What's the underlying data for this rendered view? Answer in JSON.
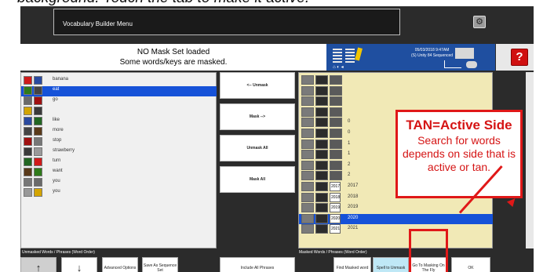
{
  "caption": "background. Touch the tab to make it active.",
  "window": {
    "title": "Vocabulary Builder Menu"
  },
  "status": {
    "line1": "NO Mask Set loaded",
    "line2": "Some words/keys are masked.",
    "datetime_line1": "05/03/2018 9:47AM",
    "datetime_line2": "(S) Unity 84 Sequenced"
  },
  "left_list": {
    "items": [
      {
        "label": "banana"
      },
      {
        "label": "eat",
        "selected": true
      },
      {
        "label": "go"
      },
      {
        "label": ""
      },
      {
        "label": "like"
      },
      {
        "label": "more"
      },
      {
        "label": "stop"
      },
      {
        "label": "strawberry"
      },
      {
        "label": "turn"
      },
      {
        "label": "want"
      },
      {
        "label": "you"
      },
      {
        "label": "you"
      }
    ],
    "footer_label": "Unmasked Words / Phrases (Word Order)"
  },
  "middle_buttons": {
    "unmask": "<-- Unmask",
    "mask": "Mask -->",
    "unmask_all": "Unmask All",
    "mask_all": "Mask All"
  },
  "right_list": {
    "items": [
      {
        "number": "",
        "year": ""
      },
      {
        "number": "",
        "year": ""
      },
      {
        "number": "",
        "year": ""
      },
      {
        "number": "",
        "year": ""
      },
      {
        "number": "0",
        "year": ""
      },
      {
        "number": "0",
        "year": ""
      },
      {
        "number": "1",
        "year": ""
      },
      {
        "number": "1",
        "year": ""
      },
      {
        "number": "2",
        "year": ""
      },
      {
        "number": "2",
        "year": ""
      },
      {
        "number": "2017",
        "year": "2017"
      },
      {
        "number": "2018",
        "year": "2018"
      },
      {
        "number": "2019",
        "year": "2019"
      },
      {
        "number": "2020",
        "year": "2020",
        "selected": true
      },
      {
        "number": "2021",
        "year": "2021"
      }
    ],
    "footer_label": "Masked Words / Phrases (Word Order)"
  },
  "callout": {
    "heading": "TAN=Active Side",
    "body": "Search for words depends on side that is active or tan."
  },
  "bottom_bar": {
    "up": "↑",
    "down": "↓",
    "advanced": "Advanced Options",
    "save_seq": "Save As Sequence Set",
    "include_all": "Include All Phrases",
    "find_masked": "Find Masked word",
    "spell_to_unmask": "Spell to Unmask",
    "go_to_masking": "Go To Masking On The Fly",
    "ok": "OK"
  },
  "help_label": "?",
  "colors": {
    "background": "#2b2b2b",
    "active_tan": "#f1e9b6",
    "selection_blue": "#1652d8",
    "accent_red": "#e01818",
    "status_panel_blue": "#1f4fa0"
  },
  "icons": [
    "settings-icon",
    "help-icon",
    "picture-icon"
  ]
}
